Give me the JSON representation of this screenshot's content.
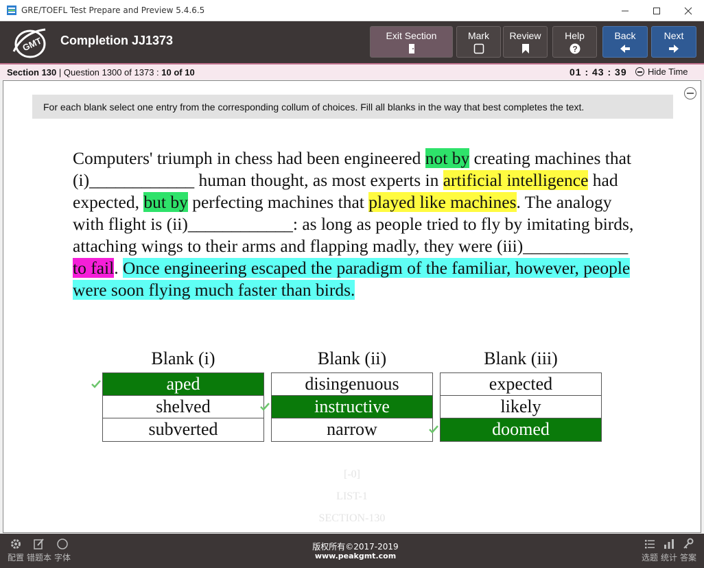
{
  "window": {
    "title": "GRE/TOEFL Test Prepare and Preview 5.4.6.5",
    "minimize_icon": "minimize-icon",
    "maximize_icon": "maximize-icon",
    "close_icon": "close-icon"
  },
  "header": {
    "logo_text": "GMT",
    "title": "Completion JJ1373",
    "buttons": {
      "exit": {
        "label": "Exit Section",
        "icon": "exit-door-icon"
      },
      "mark": {
        "label": "Mark",
        "icon": "checkbox-icon"
      },
      "review": {
        "label": "Review",
        "icon": "bookmark-icon"
      },
      "help": {
        "label": "Help",
        "icon": "question-icon"
      },
      "back": {
        "label": "Back",
        "icon": "arrow-left-icon"
      },
      "next": {
        "label": "Next",
        "icon": "arrow-right-icon"
      }
    }
  },
  "info": {
    "section": "Section 130",
    "sep": " | ",
    "question": "Question 1300 of 1373 : ",
    "count": "10 of 10",
    "time": "01 : 43 : 39",
    "hide_time": "Hide Time"
  },
  "instructions": "For each blank select one entry from the corresponding collum of choices. Fill all blanks in the way that best completes the text.",
  "passage": {
    "p1": "Computers' triumph in chess had been engineered ",
    "hl1": "not by",
    "p2": " creating machines that (i)____________ human thought, as most experts in ",
    "hl2": "artificial intelligence",
    "p3": " had expected, ",
    "hl3": "but by",
    "p4": " perfecting machines that ",
    "hl4": "played like machines",
    "p5": ". The analogy with flight is (ii)____________: as long as people tried to fly by imitating birds, attaching wings to their arms and flapping madly, they were (iii)____________ ",
    "hl5": "to fail",
    "p6": ". ",
    "hl6": "Once engineering escaped the paradigm of the familiar, however, people were soon flying much faster than birds."
  },
  "blanks": [
    {
      "title": "Blank (i)",
      "choices": [
        "aped",
        "shelved",
        "subverted"
      ],
      "selected": "aped"
    },
    {
      "title": "Blank (ii)",
      "choices": [
        "disingenuous",
        "instructive",
        "narrow"
      ],
      "selected": "instructive"
    },
    {
      "title": "Blank (iii)",
      "choices": [
        "expected",
        "likely",
        "doomed"
      ],
      "selected": "doomed"
    }
  ],
  "faint_meta": [
    "[-0]",
    "LIST-1",
    "SECTION-130"
  ],
  "footer": {
    "tools_left": [
      {
        "label": "配置",
        "icon": "gear-icon"
      },
      {
        "label": "错题本",
        "icon": "edit-icon"
      },
      {
        "label": "字体",
        "icon": "circle-icon"
      }
    ],
    "copyright_line1": "版权所有©2017-2019",
    "copyright_line2": "www.peakgmt.com",
    "tools_right": [
      {
        "label": "选题",
        "icon": "list-icon"
      },
      {
        "label": "统计",
        "icon": "bar-chart-icon"
      },
      {
        "label": "答案",
        "icon": "key-icon"
      }
    ]
  },
  "colors": {
    "header_bg": "#3c3636",
    "selected_choice": "#0a7a0a",
    "highlight_green": "#2ee26a",
    "highlight_yellow": "#fffb40",
    "highlight_magenta": "#f51fd8",
    "highlight_cyan": "#5ffff5",
    "nav_blue": "#2f5a94"
  }
}
